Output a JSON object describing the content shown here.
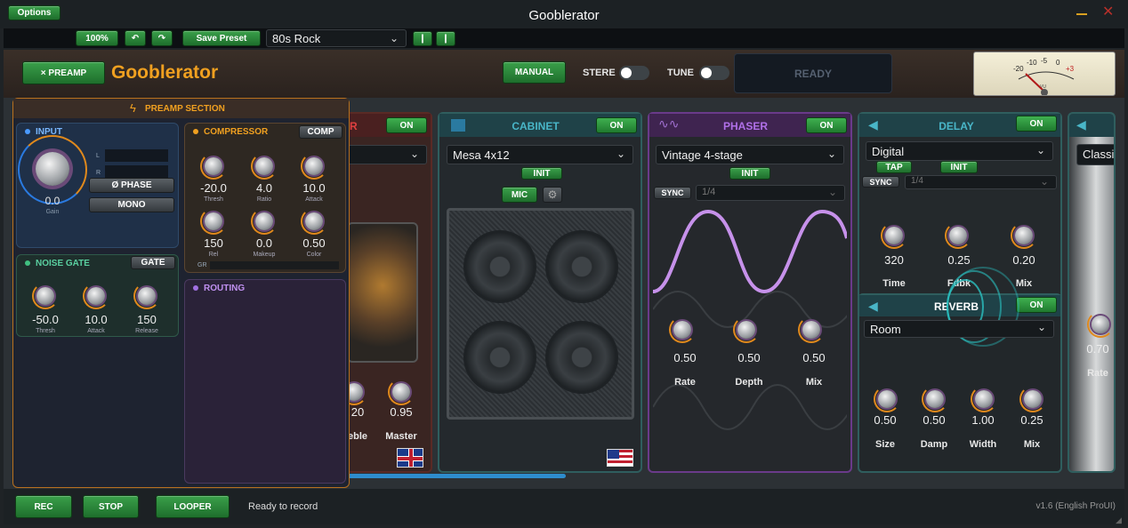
{
  "window": {
    "title": "Gooblerator",
    "options_label": "Options",
    "minimize_icon": "minimize-icon",
    "close_icon": "close-icon"
  },
  "toolbar": {
    "zoom_label": "100%",
    "undo_icon": "undo-icon",
    "redo_icon": "redo-icon",
    "save_preset_label": "Save Preset",
    "preset_value": "80s Rock"
  },
  "header": {
    "preamp_button_label": "× PREAMP",
    "app_name": "Gooblerator",
    "manual_label": "MANUAL",
    "stereo_label": "STERE",
    "tune_label": "TUNE",
    "status_display": "READY",
    "meter_labels": [
      "-20",
      "-10",
      "-5",
      "0",
      "+3"
    ],
    "meter_unit": "VU",
    "accent": "#f0a020"
  },
  "preamp": {
    "title": "PREAMP SECTION",
    "input": {
      "title": "INPUT",
      "gain_value": "0.0",
      "gain_label": "Gain",
      "l_label": "L",
      "r_label": "R",
      "phase_label": "Ø PHASE",
      "mono_label": "MONO"
    },
    "compressor": {
      "title": "COMPRESSOR",
      "button": "COMP",
      "gr_label": "GR",
      "knobs": [
        {
          "value": "-20.0",
          "label": "Thresh"
        },
        {
          "value": "4.0",
          "label": "Ratio"
        },
        {
          "value": "10.0",
          "label": "Attack"
        },
        {
          "value": "150",
          "label": "Rel"
        },
        {
          "value": "0.0",
          "label": "Makeup"
        },
        {
          "value": "0.50",
          "label": "Color"
        }
      ]
    },
    "noise_gate": {
      "title": "NOISE GATE",
      "button": "GATE",
      "knobs": [
        {
          "value": "-50.0",
          "label": "Thresh"
        },
        {
          "value": "10.0",
          "label": "Attack"
        },
        {
          "value": "150",
          "label": "Release"
        }
      ]
    },
    "routing": {
      "title": "ROUTING"
    }
  },
  "amp": {
    "title_fragment": "R",
    "on_label": "ON",
    "knobs": [
      {
        "value": "20",
        "label": "eble"
      },
      {
        "value": "0.95",
        "label": "Master"
      }
    ],
    "flag_icon": "uk-flag-icon"
  },
  "cabinet": {
    "title": "CABINET",
    "on_label": "ON",
    "model": "Mesa 4x12",
    "init_label": "INIT",
    "mic_label": "MIC",
    "gear_icon": "gear-icon",
    "flag_icon": "us-flag-icon"
  },
  "phaser": {
    "title": "PHASER",
    "on_label": "ON",
    "model": "Vintage 4-stage",
    "init_label": "INIT",
    "sync_label": "SYNC",
    "sync_value": "1/4",
    "knobs": [
      {
        "value": "0.50",
        "label": "Rate"
      },
      {
        "value": "0.50",
        "label": "Depth"
      },
      {
        "value": "0.50",
        "label": "Mix"
      }
    ]
  },
  "delay": {
    "title": "DELAY",
    "on_label": "ON",
    "model": "Digital",
    "tap_label": "TAP",
    "init_label": "INIT",
    "sync_label": "SYNC",
    "sync_value": "1/4",
    "knobs": [
      {
        "value": "320",
        "label": "Time"
      },
      {
        "value": "0.25",
        "label": "Fdbk"
      },
      {
        "value": "0.20",
        "label": "Mix"
      }
    ]
  },
  "reverb": {
    "title": "REVERB",
    "on_label": "ON",
    "model": "Room",
    "knobs": [
      {
        "value": "0.50",
        "label": "Size"
      },
      {
        "value": "0.50",
        "label": "Damp"
      },
      {
        "value": "1.00",
        "label": "Width"
      },
      {
        "value": "0.25",
        "label": "Mix"
      }
    ]
  },
  "next_panel": {
    "model_fragment": "Classi",
    "knob_value": "0.70",
    "knob_label": "Rate"
  },
  "footer": {
    "rec_label": "REC",
    "stop_label": "STOP",
    "looper_label": "LOOPER",
    "status": "Ready to record",
    "version": "v1.6 (English ProUI)"
  }
}
